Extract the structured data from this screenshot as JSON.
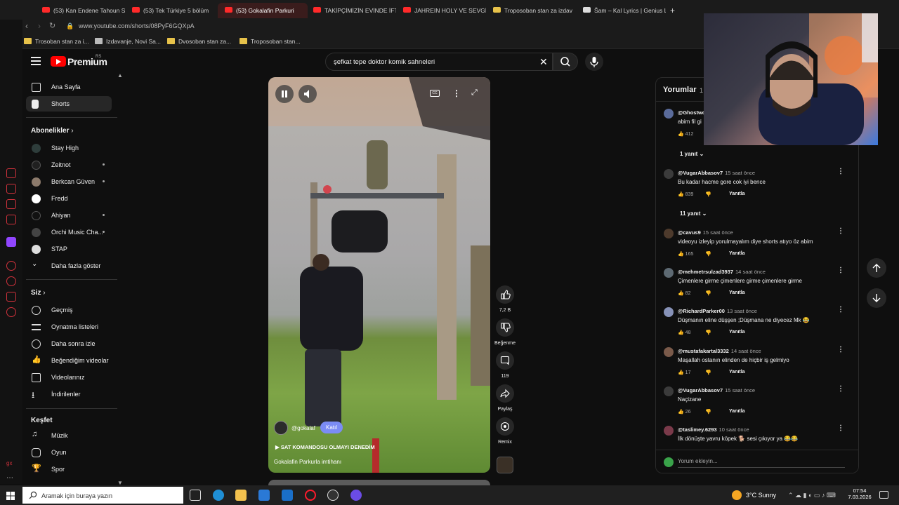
{
  "browser": {
    "tabs": [
      {
        "label": "(53) Kan Endene Tahoun S"
      },
      {
        "label": "(53) Tek Türkiye 5 bölüm"
      },
      {
        "label": "(53) Gokalafin Parkuri"
      },
      {
        "label": "TAKİPÇİMİZİN EVİNDE İFT"
      },
      {
        "label": "JAHREIN HOLY VE SEVGİ"
      },
      {
        "label": "Troposoban stan za izdav"
      },
      {
        "label": "Šam – Kal Lyrics | Genius L"
      }
    ],
    "new_tab": "+",
    "url": "www.youtube.com/shorts/08PyF6GQXpA",
    "bookmarks": [
      "Trosoban stan za i...",
      "Izdavanje, Novi Sa...",
      "Dvosoban stan za...",
      "Troposoban stan..."
    ]
  },
  "header": {
    "brand": "Premium",
    "country": "RS",
    "search_query": "şefkat tepe doktor komik sahneleri"
  },
  "sidebar": {
    "main": [
      {
        "label": "Ana Sayfa"
      },
      {
        "label": "Shorts"
      }
    ],
    "subs_title": "Abonelikler",
    "subs": [
      {
        "label": "Stay High"
      },
      {
        "label": "Zeitnot"
      },
      {
        "label": "Berkcan Güven"
      },
      {
        "label": "Fredd"
      },
      {
        "label": "Ahiyan"
      },
      {
        "label": "Orchi Music Cha..."
      },
      {
        "label": "STAP"
      },
      {
        "label": "Daha fazla göster"
      }
    ],
    "you_title": "Siz",
    "you": [
      {
        "label": "Geçmiş"
      },
      {
        "label": "Oynatma listeleri"
      },
      {
        "label": "Daha sonra izle"
      },
      {
        "label": "Beğendiğim videolar"
      },
      {
        "label": "Videolarınız"
      },
      {
        "label": "İndirilenler"
      }
    ],
    "explore_title": "Keşfet",
    "explore": [
      {
        "label": "Müzik"
      },
      {
        "label": "Oyun"
      },
      {
        "label": "Spor"
      }
    ]
  },
  "video": {
    "channel": "@gokalaf",
    "join_label": "Katıl",
    "caption_link": "SAT KOMANDOSU OLMAYI DENEDİM",
    "title": "Gokalafin Parkurla imtihanı"
  },
  "actions": {
    "likes": "7,2 B",
    "dislike_label": "Beğenme",
    "comments": "119",
    "share_label": "Paylaş",
    "remix_label": "Remix"
  },
  "comments": {
    "title": "Yorumlar",
    "count": "1",
    "add_placeholder": "Yorum ekleyin...",
    "reply_label": "Yanıtla",
    "items": [
      {
        "user": "@Ghostwo",
        "time": "",
        "text": "abim fil gi",
        "likes": "412",
        "replies": "1 yanıt"
      },
      {
        "user": "@VugarAbbasov7",
        "time": "15 saat önce",
        "text": "Bu kadar hacme gore cok iyi bence",
        "likes": "839",
        "replies": "11 yanıt"
      },
      {
        "user": "@cavus9",
        "time": "15 saat önce",
        "text": "videoyu izleyip yorulmayalım diye shorts atıyo öz abim",
        "likes": "165",
        "replies": ""
      },
      {
        "user": "@mehmetrsulzad3937",
        "time": "14 saat önce",
        "text": "Çimenlere girme çimenlere girme çimenlere girme",
        "likes": "82",
        "replies": ""
      },
      {
        "user": "@RichardParker00",
        "time": "13 saat önce",
        "text": "Düşmanın eline düşşen ;Düşmana ne diyecez Mk 😂",
        "likes": "48",
        "replies": ""
      },
      {
        "user": "@mustafakartal3332",
        "time": "14 saat önce",
        "text": "Maşallah ostanın elinden de hiçbir iş gelmiyo",
        "likes": "17",
        "replies": ""
      },
      {
        "user": "@VugarAbbasov7",
        "time": "15 saat önce",
        "text": "Naçizane",
        "likes": "26",
        "replies": ""
      },
      {
        "user": "@taslimey.6293",
        "time": "10 saat önce",
        "text": "İlk dönüşte yavru köpek 🐕 sesi çıkıyor ya 😂😂",
        "likes": "",
        "replies": ""
      }
    ]
  },
  "taskbar": {
    "search_placeholder": "Aramak için buraya yazın",
    "weather": "3°C  Sunny",
    "time": "07:54",
    "date": "7.03.2026"
  }
}
